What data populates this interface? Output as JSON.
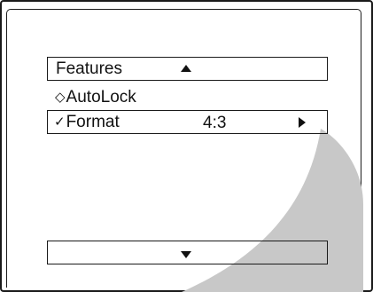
{
  "menu": {
    "features": {
      "label": "Features",
      "up_icon": "triangle-up-icon"
    },
    "autolock": {
      "marker": "◇",
      "label": "AutoLock"
    },
    "format": {
      "marker": "✓",
      "label": "Format",
      "value": "4:3",
      "next_icon": "triangle-right-icon"
    },
    "scroll_down_icon": "triangle-down-icon"
  },
  "colors": {
    "frame": "#1a1a1a",
    "pointer_shadow": "#c8c8c8",
    "background": "#ffffff"
  }
}
